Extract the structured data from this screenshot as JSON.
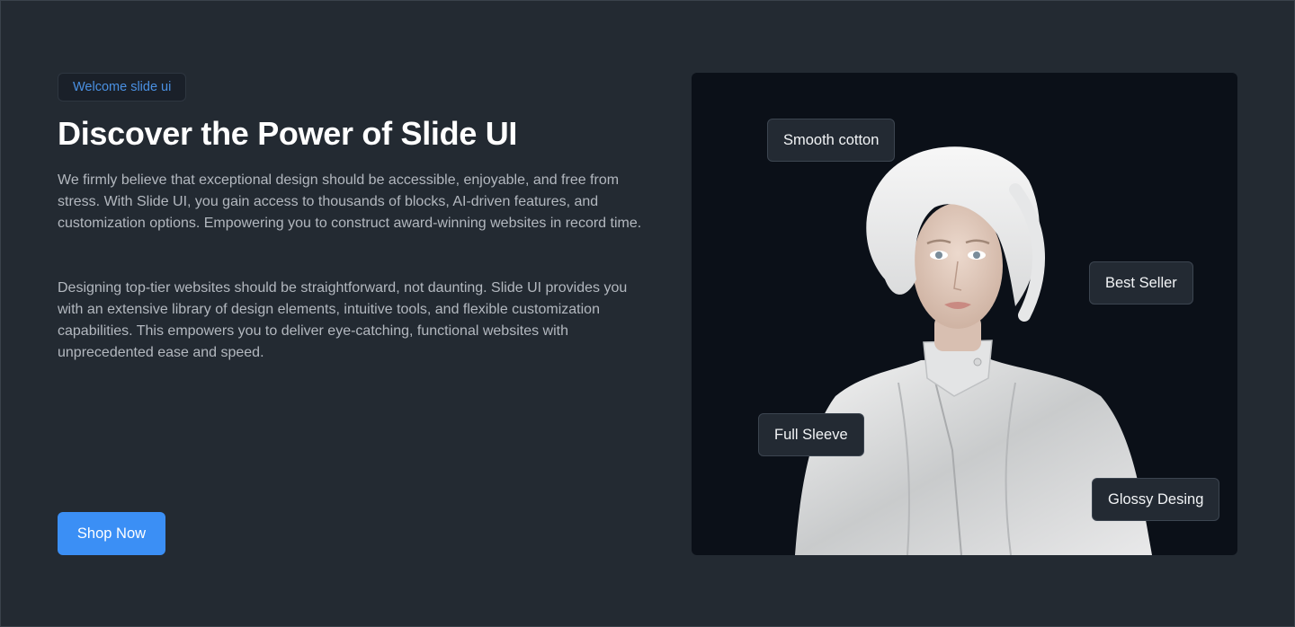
{
  "badge": "Welcome slide ui",
  "headline": "Discover the Power of Slide UI",
  "paragraphs": [
    " We firmly believe that exceptional design should be accessible, enjoyable, and free from stress. With Slide UI, you gain access to thousands of blocks, AI-driven features, and customization options. Empowering you to construct award-winning websites in record time.",
    "Designing top-tier websites should be straightforward, not daunting. Slide UI provides you with an extensive library of design elements, intuitive tools, and flexible customization capabilities. This empowers you to deliver eye-catching, functional websites with unprecedented ease and speed."
  ],
  "cta_label": "Shop Now",
  "tags": [
    "Smooth cotton",
    "Best Seller",
    "Full Sleeve",
    "Glossy Desing"
  ],
  "colors": {
    "background": "#232a32",
    "panel": "#0b1018",
    "accent": "#3b8ff5",
    "badge_text": "#4a90e2"
  }
}
